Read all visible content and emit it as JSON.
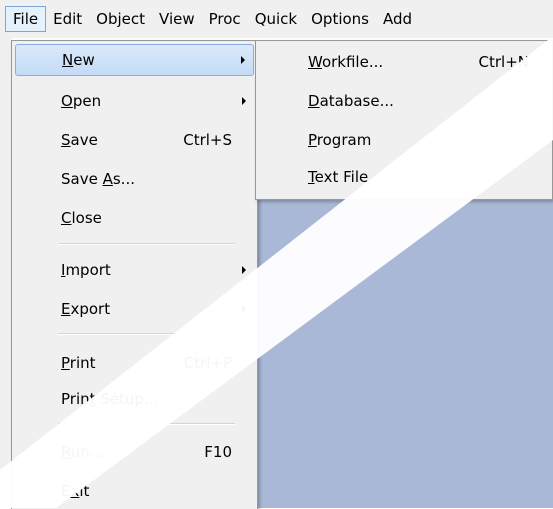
{
  "menubar": {
    "items": [
      {
        "label": "File"
      },
      {
        "label": "Edit"
      },
      {
        "label": "Object"
      },
      {
        "label": "View"
      },
      {
        "label": "Proc"
      },
      {
        "label": "Quick"
      },
      {
        "label": "Options"
      },
      {
        "label": "Add"
      }
    ]
  },
  "file_menu": {
    "new": {
      "label": "New",
      "accel": "N"
    },
    "open": {
      "label": "Open",
      "accel": "O"
    },
    "save": {
      "label": "Save",
      "accel": "S",
      "shortcut": "Ctrl+S"
    },
    "save_as": {
      "label": "Save As...",
      "accel": "A"
    },
    "close": {
      "label": "Close",
      "accel": "C"
    },
    "import": {
      "label": "Import",
      "accel": "I"
    },
    "export": {
      "label": "Export",
      "accel": "E"
    },
    "print": {
      "label": "Print",
      "accel": "P",
      "shortcut": "Ctrl+P"
    },
    "print_setup": {
      "label": "Print Setup...",
      "accel": "t"
    },
    "run": {
      "label": "Run...",
      "accel": "R",
      "shortcut": "F10"
    },
    "exit": {
      "label": "Exit",
      "accel": "x"
    }
  },
  "new_submenu": {
    "workfile": {
      "label": "Workfile...",
      "accel": "W",
      "shortcut": "Ctrl+N"
    },
    "database": {
      "label": "Database...",
      "accel": "D"
    },
    "program": {
      "label": "Program",
      "accel": "P"
    },
    "text_file": {
      "label": "Text File",
      "accel": "T"
    }
  },
  "colors": {
    "workspace": "#a9b8d6",
    "menu_bg": "#f0f0f0",
    "highlight": "#c4dbf7",
    "watermark": "#ffffff"
  }
}
